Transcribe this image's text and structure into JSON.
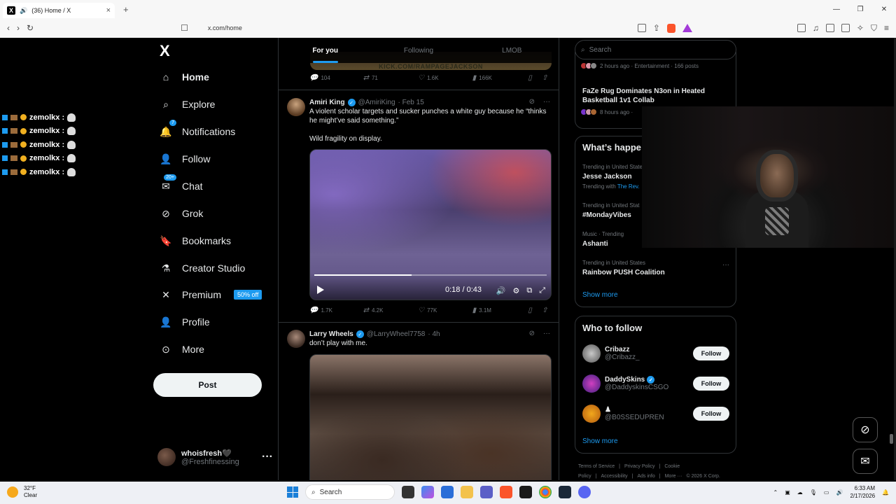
{
  "browser": {
    "tab_title": "(36) Home / X",
    "tab_close": "×",
    "new_tab": "+",
    "url": "x.com/home",
    "win_min": "—",
    "win_max": "❐",
    "win_close": "✕"
  },
  "leftnav": {
    "logo": "X",
    "items": [
      {
        "label": "Home",
        "icon": "home-icon"
      },
      {
        "label": "Explore",
        "icon": "search-icon"
      },
      {
        "label": "Notifications",
        "icon": "bell-icon",
        "badge": "7"
      },
      {
        "label": "Follow",
        "icon": "add-person-icon"
      },
      {
        "label": "Chat",
        "icon": "chat-icon",
        "badge": "20+"
      },
      {
        "label": "Grok",
        "icon": "grok-icon"
      },
      {
        "label": "Bookmarks",
        "icon": "bookmark-icon"
      },
      {
        "label": "Creator Studio",
        "icon": "flask-icon"
      },
      {
        "label": "Premium",
        "icon": "x-icon",
        "promo": "50% off"
      },
      {
        "label": "Profile",
        "icon": "person-icon"
      },
      {
        "label": "More",
        "icon": "more-circle-icon"
      }
    ],
    "post_label": "Post",
    "account": {
      "name": "whoisfresh🖤",
      "handle": "@Freshfinessing",
      "more": "···"
    }
  },
  "chat_overlay": {
    "lines": [
      "zemolkx :",
      "zemolkx :",
      "zemolkx :",
      "zemolkx :",
      "zemolkx :"
    ]
  },
  "timeline": {
    "tabs": [
      "For you",
      "Following",
      "LMOB"
    ],
    "banner_text": "KICK.COM/RAMPAGEJACKSON",
    "prev_actions": {
      "replies": "104",
      "reposts": "71",
      "likes": "1.6K",
      "views": "166K"
    },
    "tweets": [
      {
        "name": "Amiri King",
        "handle": "@AmiriKing",
        "time": "· Feb 15",
        "text1": "A violent scholar targets and sucker punches a white guy because he “thinks he might’ve said something.”",
        "text2": "Wild fragility on display.",
        "video_time": "0:18 / 0:43",
        "video_progress": 0.42,
        "actions": {
          "replies": "1.7K",
          "reposts": "4.2K",
          "likes": "77K",
          "views": "3.1M"
        }
      },
      {
        "name": "Larry Wheels",
        "handle": "@LarryWheel7758",
        "time": "· 4h",
        "text1": "don’t play with me."
      }
    ]
  },
  "rightcol": {
    "search_placeholder": "Search",
    "news": [
      {
        "meta": "2 hours ago · Entertainment · 166 posts"
      },
      {
        "title": "FaZe Rug Dominates N3on in Heated Basketball 1v1 Collab",
        "meta": "8 hours ago ·"
      }
    ],
    "whats_happening": "What’s happe",
    "trends": [
      {
        "context": "Trending in United State",
        "title": "Jesse Jackson",
        "with_label": "Trending with",
        "with_value": "The Rev."
      },
      {
        "context": "Trending in United Stat",
        "title": "#MondayVibes"
      },
      {
        "context": "Music · Trending",
        "title": "Ashanti"
      },
      {
        "context": "Trending in United States",
        "title": "Rainbow PUSH Coalition"
      }
    ],
    "trend_more": "···",
    "show_more": "Show more",
    "who_to_follow": "Who to follow",
    "follow_label": "Follow",
    "suggestions": [
      {
        "name": "Cribazz",
        "handle": "@Cribazz_",
        "verified": false
      },
      {
        "name": "DaddySkins",
        "handle": "@DaddyskinsCSGO",
        "verified": true
      },
      {
        "name": "♟",
        "handle": "@B0SSEDUPREN",
        "verified": false
      }
    ],
    "show_more_2": "Show more",
    "footer": [
      "Terms of Service",
      "|",
      "Privacy Policy",
      "|",
      "Cookie Policy",
      "|",
      "Accessibility",
      "|",
      "Ads info",
      "|",
      "More ···",
      "© 2026 X Corp."
    ]
  },
  "taskbar": {
    "temp": "32°F",
    "condition": "Clear",
    "search": "Search",
    "time": "6:33 AM",
    "date": "2/17/2026"
  }
}
